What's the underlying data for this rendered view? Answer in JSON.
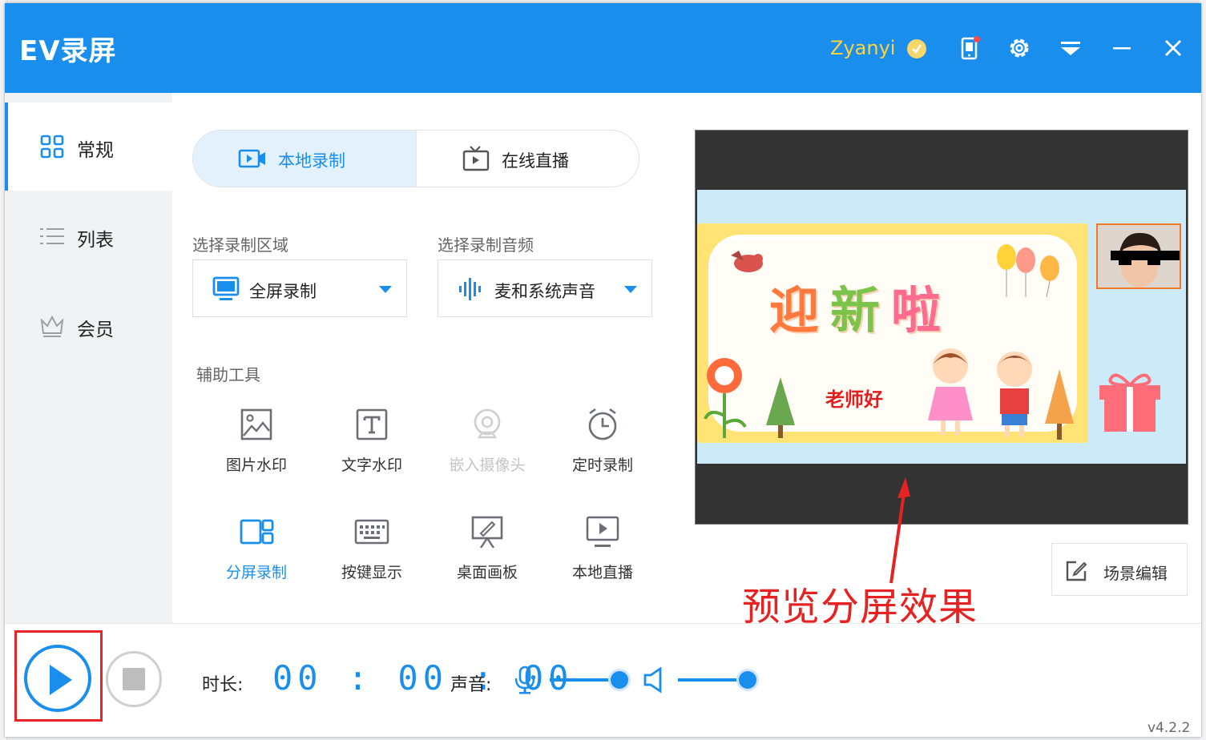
{
  "titlebar": {
    "title": "EV录屏",
    "username": "Zyanyi",
    "icons": [
      "vip-badge-icon",
      "phone-icon",
      "gear-icon",
      "menu-icon",
      "minimize-icon",
      "close-icon"
    ]
  },
  "sidebar": {
    "items": [
      {
        "label": "常规",
        "icon": "grid-icon",
        "active": true
      },
      {
        "label": "列表",
        "icon": "list-icon",
        "active": false
      },
      {
        "label": "会员",
        "icon": "crown-icon",
        "active": false
      }
    ]
  },
  "tabs": [
    {
      "label": "本地录制",
      "icon": "video-camera-icon",
      "active": true
    },
    {
      "label": "在线直播",
      "icon": "tv-play-icon",
      "active": false
    }
  ],
  "region": {
    "label": "选择录制区域",
    "value": "全屏录制",
    "icon": "monitor-icon"
  },
  "audio": {
    "label": "选择录制音频",
    "value": "麦和系统声音",
    "icon": "audio-wave-icon"
  },
  "tools": {
    "label": "辅助工具",
    "items": [
      {
        "label": "图片水印",
        "icon": "image-icon",
        "state": "normal"
      },
      {
        "label": "文字水印",
        "icon": "text-icon",
        "state": "normal"
      },
      {
        "label": "嵌入摄像头",
        "icon": "webcam-icon",
        "state": "disabled"
      },
      {
        "label": "定时录制",
        "icon": "alarm-clock-icon",
        "state": "normal"
      },
      {
        "label": "分屏录制",
        "icon": "split-screen-icon",
        "state": "selected"
      },
      {
        "label": "按键显示",
        "icon": "keyboard-icon",
        "state": "normal"
      },
      {
        "label": "桌面画板",
        "icon": "easel-icon",
        "state": "normal"
      },
      {
        "label": "本地直播",
        "icon": "monitor-play-icon",
        "state": "normal"
      }
    ]
  },
  "preview": {
    "greeting": [
      "迎",
      "新",
      "啦"
    ],
    "subtitle": "老师好"
  },
  "scene_button": {
    "label": "场景编辑"
  },
  "annotation": "预览分屏效果",
  "bottom": {
    "duration_label": "时长:",
    "timer": "00:00:00",
    "sound_label": "声音:",
    "mic_volume": 0.95,
    "speaker_volume": 0.95,
    "version": "v4.2.2"
  },
  "colors": {
    "accent": "#1a8eec",
    "annotation": "#e62222",
    "username": "#ffd33c"
  }
}
